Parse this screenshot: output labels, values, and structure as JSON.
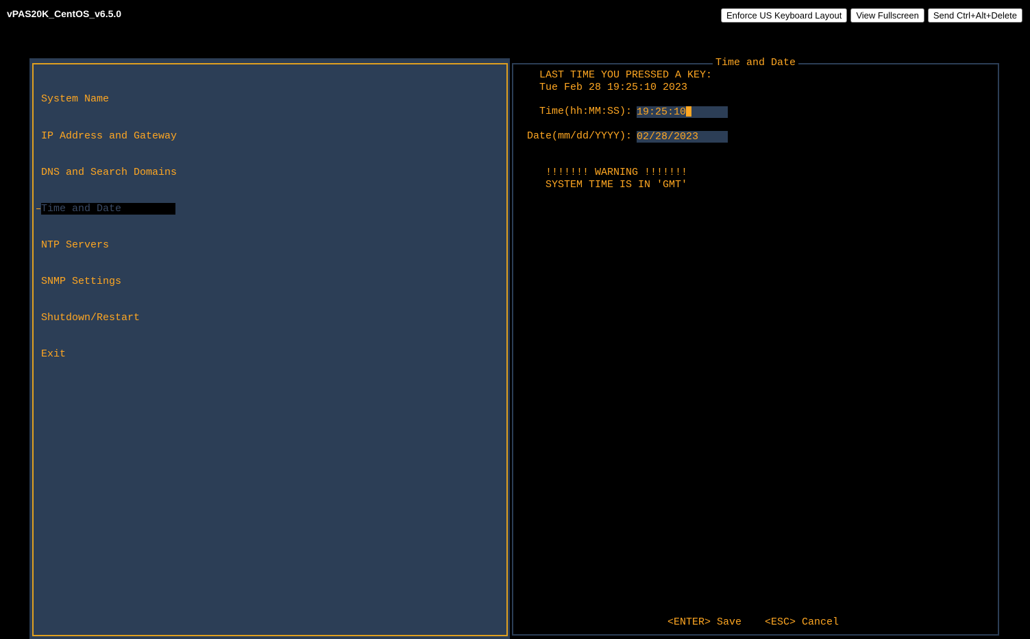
{
  "window": {
    "title": "vPAS20K_CentOS_v6.5.0"
  },
  "toolbar": {
    "buttons": [
      {
        "label": "Enforce US Keyboard Layout"
      },
      {
        "label": "View Fullscreen"
      },
      {
        "label": "Send Ctrl+Alt+Delete"
      }
    ]
  },
  "menu": {
    "items": [
      {
        "label": "System Name"
      },
      {
        "label": "IP Address and Gateway"
      },
      {
        "label": "DNS and Search Domains"
      },
      {
        "label": "Time and Date",
        "selected": true
      },
      {
        "label": "NTP Servers"
      },
      {
        "label": "SNMP Settings"
      },
      {
        "label": "Shutdown/Restart"
      },
      {
        "label": "Exit"
      }
    ]
  },
  "panel": {
    "title": "Time and Date",
    "last_key_label": "LAST TIME YOU PRESSED A KEY:",
    "last_key_value": "Tue Feb 28 19:25:10 2023",
    "time_label": "Time(hh:MM:SS):",
    "time_value": "19:25:10",
    "date_label": "Date(mm/dd/YYYY):",
    "date_value": "02/28/2023",
    "warning_line1": "!!!!!!! WARNING !!!!!!!",
    "warning_line2": "SYSTEM TIME IS IN 'GMT'",
    "save_hint": "<ENTER> Save",
    "cancel_hint": "<ESC> Cancel"
  },
  "colors": {
    "terminal_text": "#ffa722",
    "panel_bg": "#2c3e56",
    "frame_border": "#e0a020",
    "background": "#000000"
  }
}
